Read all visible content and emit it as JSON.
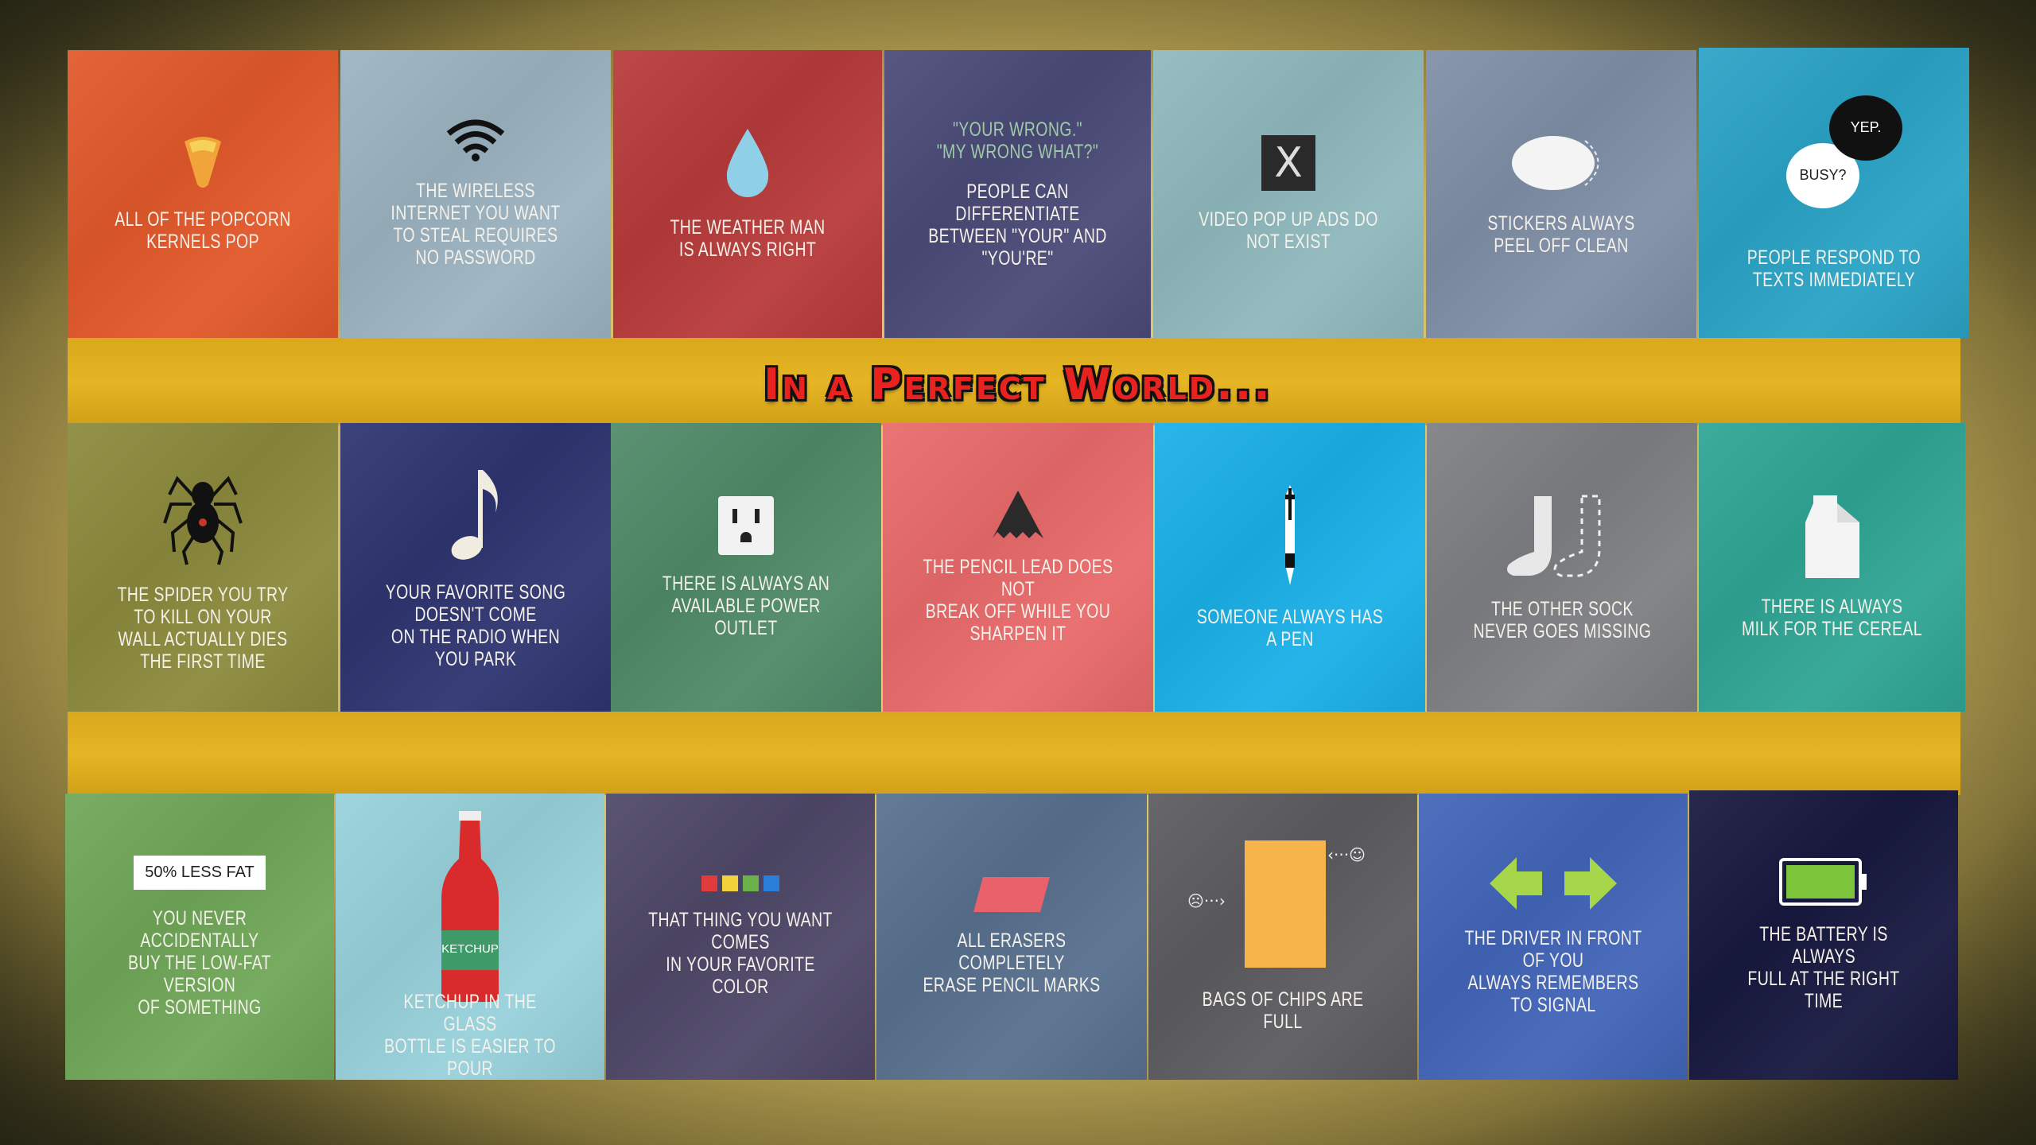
{
  "title": "In a Perfect World...",
  "tiles_row1": [
    {
      "caption": "All of the popcorn\nkernels pop",
      "color": "#e2582a",
      "icon": "popcorn-kernel-icon"
    },
    {
      "caption": "The wireless internet you want\nto steal requires no password",
      "color": "#9cb3c0",
      "icon": "wifi-icon"
    },
    {
      "caption": "The weather man\nis always right",
      "color": "#b83a3a",
      "icon": "water-drop-icon"
    },
    {
      "caption": "People can differentiate\nbetween \"your\" and \"you're\"",
      "quote": "\"Your wrong.\"\n\"My wrong what?\"",
      "color": "#4a4a78",
      "icon": "quote-text"
    },
    {
      "caption": "Video pop up ads do not exist",
      "color": "#8fb9bd",
      "icon": "close-x-icon",
      "x_label": "X"
    },
    {
      "caption": "Stickers always peel off clean",
      "color": "#7f8fa6",
      "icon": "sticker-icon"
    },
    {
      "caption": "People respond to\ntexts immediately",
      "color": "#2aa3c6",
      "icon": "speech-bubbles-icon",
      "bubble_q": "Busy?",
      "bubble_a": "Yep."
    }
  ],
  "tiles_row2": [
    {
      "caption": "The spider you try to kill on your\nwall actually dies the first time",
      "color": "#8c8a3c",
      "icon": "spider-icon"
    },
    {
      "caption": "Your favorite song doesn't come\non the radio when you park",
      "color": "#2e3470",
      "icon": "music-note-icon"
    },
    {
      "caption": "There is always an\navailable power outlet",
      "color": "#4f8a68",
      "icon": "power-outlet-icon"
    },
    {
      "caption": "The pencil lead does not\nbreak off while you sharpen it",
      "color": "#e96a6a",
      "icon": "pencil-tip-icon"
    },
    {
      "caption": "Someone always has a pen",
      "color": "#1ab0e8",
      "icon": "pen-icon"
    },
    {
      "caption": "The other sock\nnever goes missing",
      "color": "#7d7f82",
      "icon": "socks-icon"
    },
    {
      "caption": "There is always\nmilk for the cereal",
      "color": "#2fa594",
      "icon": "milk-carton-icon"
    }
  ],
  "tiles_row3": [
    {
      "caption": "You never accidentally\nbuy the low-fat version\nof something",
      "color": "#6fa758",
      "icon": "label-icon",
      "label": "50% less fat"
    },
    {
      "caption": "Ketchup in the glass\nbottle is easier to pour",
      "color": "#97d1db",
      "icon": "ketchup-bottle-icon",
      "bottle_label": "Ketchup"
    },
    {
      "caption": "That thing you want comes\nin your favorite color",
      "color": "#4e4768",
      "icon": "color-swatches-icon"
    },
    {
      "caption": "All erasers completely\nerase pencil marks",
      "color": "#58708f",
      "icon": "eraser-icon"
    },
    {
      "caption": "Bags of chips are full",
      "color": "#5c5b5f",
      "icon": "chip-bag-icon",
      "sad": "☹···›",
      "happy": "‹···☺"
    },
    {
      "caption": "The driver in front of you\nalways remembers to signal",
      "color": "#4165b8",
      "icon": "turn-signal-icon"
    },
    {
      "caption": "The battery is always\nfull at the right time",
      "color": "#17183f",
      "icon": "battery-icon"
    }
  ]
}
